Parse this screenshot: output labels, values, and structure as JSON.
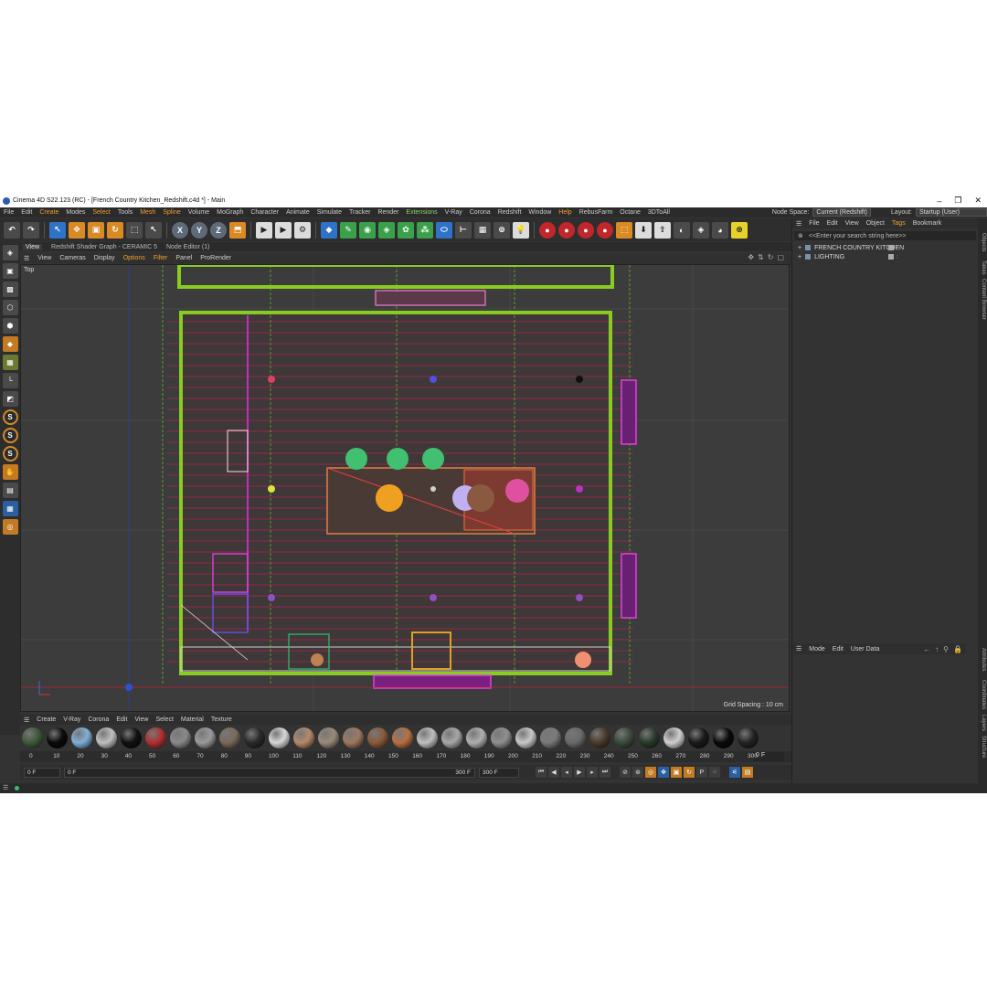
{
  "window": {
    "title": "Cinema 4D S22.123 (RC) - [French Country Kitchen_Redshift.c4d *] - Main",
    "minimize": "–",
    "restore": "❐",
    "close": "✕"
  },
  "menubar": {
    "items": [
      "File",
      "Edit",
      "Create",
      "Modes",
      "Select",
      "Tools",
      "Mesh",
      "Spline",
      "Volume",
      "MoGraph",
      "Character",
      "Animate",
      "Simulate",
      "Tracker",
      "Render",
      "Extensions",
      "V-Ray",
      "Corona",
      "Redshift",
      "Window",
      "Help",
      "RebusFarm",
      "Octane",
      "3DToAll"
    ],
    "node_space_label": "Node Space:",
    "node_space_value": "Current (Redshift)",
    "layout_label": "Layout:",
    "layout_value": "Startup (User)"
  },
  "viewport_tabs": {
    "tabs": [
      "View",
      "Redshift Shader Graph - CERAMIC 5",
      "Node Editor (1)"
    ]
  },
  "viewport_menu": {
    "items": [
      "View",
      "Cameras",
      "Display",
      "Options",
      "Filter",
      "Panel",
      "ProRender"
    ]
  },
  "viewport": {
    "view_name": "Top",
    "grid_spacing": "Grid Spacing : 10 cm"
  },
  "object_manager": {
    "menu": [
      "File",
      "Edit",
      "View",
      "Object",
      "Tags",
      "Bookmark"
    ],
    "search_placeholder": "<<Enter your search string here>>",
    "objects": [
      {
        "name": "FRENCH COUNTRY KITCHEN"
      },
      {
        "name": "LIGHTING"
      }
    ]
  },
  "attribute_manager": {
    "menu": [
      "Mode",
      "Edit",
      "User Data"
    ]
  },
  "side_tabs": [
    "Objects",
    "Takes",
    "Content Browser",
    "Attributes",
    "Coordinates",
    "Layers",
    "Structure"
  ],
  "material_manager": {
    "menu": [
      "Create",
      "V-Ray",
      "Corona",
      "Edit",
      "View",
      "Select",
      "Material",
      "Texture"
    ],
    "swatch_colors": [
      "#3f5a3a",
      "#0a0a0a",
      "#7fb0d8",
      "#bfbfbf",
      "#111111",
      "#b03030",
      "#8a8a8a",
      "#9a9a9a",
      "#7a6a5a",
      "#2a2a2a",
      "#d8d8d8",
      "#b58a6a",
      "#9a8a7a",
      "#a07860",
      "#8a5a3a",
      "#b87040",
      "#c0c0c0",
      "#a8a8a8",
      "#b0b0b0",
      "#909090",
      "#c8c8c8",
      "#7a7a7a",
      "#6a6a6a",
      "#4a3a2a",
      "#3a4a3a",
      "#2a3a2a",
      "#cfcfcf",
      "#1a1a1a",
      "#0a0a0a",
      "#222222"
    ]
  },
  "timeline": {
    "ticks": [
      "0",
      "10",
      "20",
      "30",
      "40",
      "50",
      "60",
      "70",
      "80",
      "90",
      "100",
      "110",
      "120",
      "130",
      "140",
      "150",
      "160",
      "170",
      "180",
      "190",
      "200",
      "210",
      "220",
      "230",
      "240",
      "250",
      "260",
      "270",
      "280",
      "290",
      "300"
    ],
    "current_frame": "0 F"
  },
  "transport": {
    "start": "0 F",
    "current": "0 F",
    "end_left": "300 F",
    "end_right": "300 F"
  }
}
